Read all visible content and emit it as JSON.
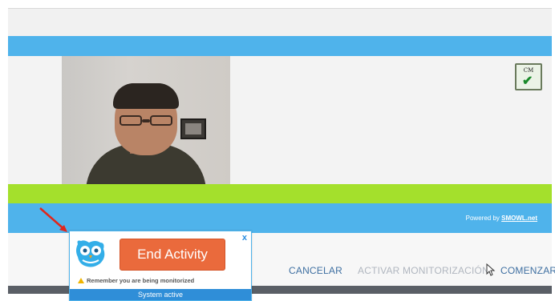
{
  "camera_module": {
    "label": "CM",
    "status_icon": "check-icon",
    "powered_prefix": "Powered by ",
    "powered_brand": "SMOWL.net"
  },
  "nav": {
    "cancel_label": "CANCELAR",
    "activate_label": "ACTIVAR MONITORIZACIÓN",
    "start_label": "COMENZAR"
  },
  "popup": {
    "close_label": "x",
    "end_button_label": "End Activity",
    "remember_text": "Remember you are being monitorized",
    "status_text": "System active"
  },
  "colors": {
    "accent_blue": "#4fb3eb",
    "green_bar": "#a4e02c",
    "end_button": "#ea6a3c",
    "status_bar": "#2f8ed8",
    "arrow": "#e0261c"
  }
}
